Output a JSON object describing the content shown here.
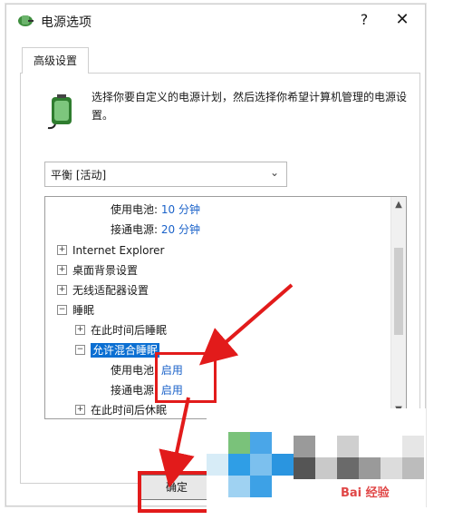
{
  "window": {
    "title": "电源选项",
    "help_label": "?",
    "close_label": "✕"
  },
  "tab": {
    "label": "高级设置"
  },
  "description": "选择你要自定义的电源计划，然后选择你希望计算机管理的电源设置。",
  "plan_select": {
    "value": "平衡 [活动]"
  },
  "tree": {
    "rows": [
      {
        "label": "使用电池:",
        "value": "10 分钟"
      },
      {
        "label": "接通电源:",
        "value": "20 分钟"
      },
      {
        "label": "Internet Explorer"
      },
      {
        "label": "桌面背景设置"
      },
      {
        "label": "无线适配器设置"
      },
      {
        "label": "睡眠"
      },
      {
        "label": "在此时间后睡眠"
      },
      {
        "label": "允许混合睡眠"
      },
      {
        "label": "使用电池:",
        "value": "启用"
      },
      {
        "label": "接通电源:",
        "value": "启用"
      },
      {
        "label": "在此时间后休眠"
      }
    ],
    "expander_plus": "+",
    "expander_minus": "−"
  },
  "ok_button": {
    "label": "确定"
  },
  "watermark": {
    "text": "Bai 经验"
  },
  "colors": {
    "accent_blue": "#0b6fd2",
    "value_blue": "#1a62c9",
    "annotation_red": "#e21b1b"
  }
}
